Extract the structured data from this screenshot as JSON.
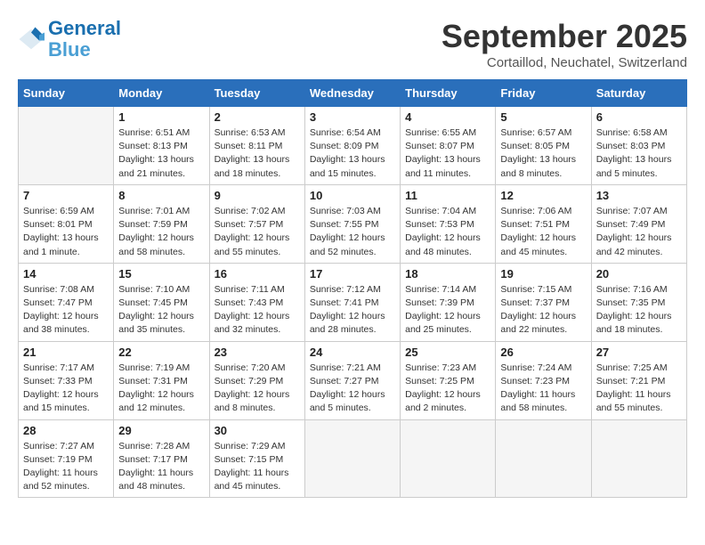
{
  "logo": {
    "line1": "General",
    "line2": "Blue"
  },
  "title": "September 2025",
  "location": "Cortaillod, Neuchatel, Switzerland",
  "days_of_week": [
    "Sunday",
    "Monday",
    "Tuesday",
    "Wednesday",
    "Thursday",
    "Friday",
    "Saturday"
  ],
  "weeks": [
    [
      {
        "day": "",
        "info": ""
      },
      {
        "day": "1",
        "info": "Sunrise: 6:51 AM\nSunset: 8:13 PM\nDaylight: 13 hours\nand 21 minutes."
      },
      {
        "day": "2",
        "info": "Sunrise: 6:53 AM\nSunset: 8:11 PM\nDaylight: 13 hours\nand 18 minutes."
      },
      {
        "day": "3",
        "info": "Sunrise: 6:54 AM\nSunset: 8:09 PM\nDaylight: 13 hours\nand 15 minutes."
      },
      {
        "day": "4",
        "info": "Sunrise: 6:55 AM\nSunset: 8:07 PM\nDaylight: 13 hours\nand 11 minutes."
      },
      {
        "day": "5",
        "info": "Sunrise: 6:57 AM\nSunset: 8:05 PM\nDaylight: 13 hours\nand 8 minutes."
      },
      {
        "day": "6",
        "info": "Sunrise: 6:58 AM\nSunset: 8:03 PM\nDaylight: 13 hours\nand 5 minutes."
      }
    ],
    [
      {
        "day": "7",
        "info": "Sunrise: 6:59 AM\nSunset: 8:01 PM\nDaylight: 13 hours\nand 1 minute."
      },
      {
        "day": "8",
        "info": "Sunrise: 7:01 AM\nSunset: 7:59 PM\nDaylight: 12 hours\nand 58 minutes."
      },
      {
        "day": "9",
        "info": "Sunrise: 7:02 AM\nSunset: 7:57 PM\nDaylight: 12 hours\nand 55 minutes."
      },
      {
        "day": "10",
        "info": "Sunrise: 7:03 AM\nSunset: 7:55 PM\nDaylight: 12 hours\nand 52 minutes."
      },
      {
        "day": "11",
        "info": "Sunrise: 7:04 AM\nSunset: 7:53 PM\nDaylight: 12 hours\nand 48 minutes."
      },
      {
        "day": "12",
        "info": "Sunrise: 7:06 AM\nSunset: 7:51 PM\nDaylight: 12 hours\nand 45 minutes."
      },
      {
        "day": "13",
        "info": "Sunrise: 7:07 AM\nSunset: 7:49 PM\nDaylight: 12 hours\nand 42 minutes."
      }
    ],
    [
      {
        "day": "14",
        "info": "Sunrise: 7:08 AM\nSunset: 7:47 PM\nDaylight: 12 hours\nand 38 minutes."
      },
      {
        "day": "15",
        "info": "Sunrise: 7:10 AM\nSunset: 7:45 PM\nDaylight: 12 hours\nand 35 minutes."
      },
      {
        "day": "16",
        "info": "Sunrise: 7:11 AM\nSunset: 7:43 PM\nDaylight: 12 hours\nand 32 minutes."
      },
      {
        "day": "17",
        "info": "Sunrise: 7:12 AM\nSunset: 7:41 PM\nDaylight: 12 hours\nand 28 minutes."
      },
      {
        "day": "18",
        "info": "Sunrise: 7:14 AM\nSunset: 7:39 PM\nDaylight: 12 hours\nand 25 minutes."
      },
      {
        "day": "19",
        "info": "Sunrise: 7:15 AM\nSunset: 7:37 PM\nDaylight: 12 hours\nand 22 minutes."
      },
      {
        "day": "20",
        "info": "Sunrise: 7:16 AM\nSunset: 7:35 PM\nDaylight: 12 hours\nand 18 minutes."
      }
    ],
    [
      {
        "day": "21",
        "info": "Sunrise: 7:17 AM\nSunset: 7:33 PM\nDaylight: 12 hours\nand 15 minutes."
      },
      {
        "day": "22",
        "info": "Sunrise: 7:19 AM\nSunset: 7:31 PM\nDaylight: 12 hours\nand 12 minutes."
      },
      {
        "day": "23",
        "info": "Sunrise: 7:20 AM\nSunset: 7:29 PM\nDaylight: 12 hours\nand 8 minutes."
      },
      {
        "day": "24",
        "info": "Sunrise: 7:21 AM\nSunset: 7:27 PM\nDaylight: 12 hours\nand 5 minutes."
      },
      {
        "day": "25",
        "info": "Sunrise: 7:23 AM\nSunset: 7:25 PM\nDaylight: 12 hours\nand 2 minutes."
      },
      {
        "day": "26",
        "info": "Sunrise: 7:24 AM\nSunset: 7:23 PM\nDaylight: 11 hours\nand 58 minutes."
      },
      {
        "day": "27",
        "info": "Sunrise: 7:25 AM\nSunset: 7:21 PM\nDaylight: 11 hours\nand 55 minutes."
      }
    ],
    [
      {
        "day": "28",
        "info": "Sunrise: 7:27 AM\nSunset: 7:19 PM\nDaylight: 11 hours\nand 52 minutes."
      },
      {
        "day": "29",
        "info": "Sunrise: 7:28 AM\nSunset: 7:17 PM\nDaylight: 11 hours\nand 48 minutes."
      },
      {
        "day": "30",
        "info": "Sunrise: 7:29 AM\nSunset: 7:15 PM\nDaylight: 11 hours\nand 45 minutes."
      },
      {
        "day": "",
        "info": ""
      },
      {
        "day": "",
        "info": ""
      },
      {
        "day": "",
        "info": ""
      },
      {
        "day": "",
        "info": ""
      }
    ]
  ]
}
